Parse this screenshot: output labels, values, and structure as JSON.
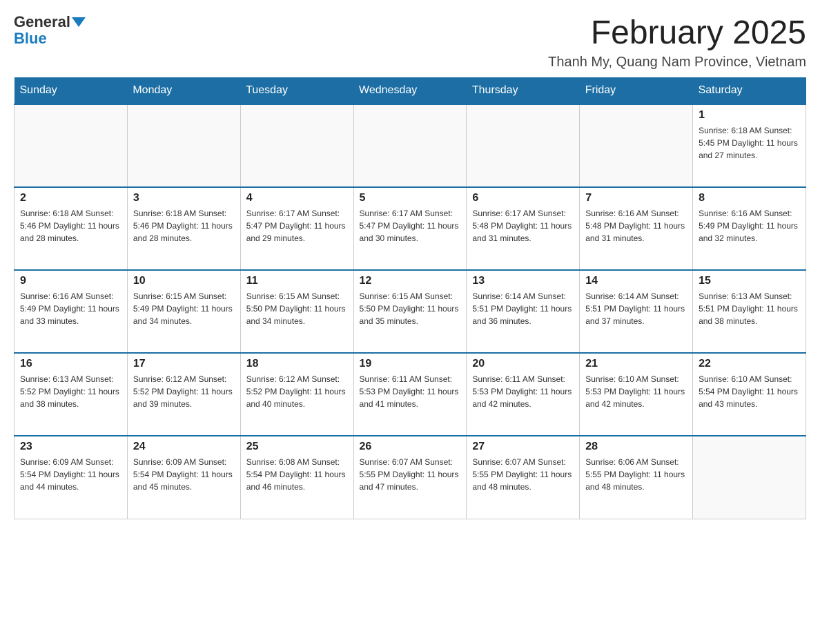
{
  "header": {
    "logo_general": "General",
    "logo_blue": "Blue",
    "title": "February 2025",
    "subtitle": "Thanh My, Quang Nam Province, Vietnam"
  },
  "weekdays": [
    "Sunday",
    "Monday",
    "Tuesday",
    "Wednesday",
    "Thursday",
    "Friday",
    "Saturday"
  ],
  "weeks": [
    [
      {
        "day": "",
        "info": ""
      },
      {
        "day": "",
        "info": ""
      },
      {
        "day": "",
        "info": ""
      },
      {
        "day": "",
        "info": ""
      },
      {
        "day": "",
        "info": ""
      },
      {
        "day": "",
        "info": ""
      },
      {
        "day": "1",
        "info": "Sunrise: 6:18 AM\nSunset: 5:45 PM\nDaylight: 11 hours and 27 minutes."
      }
    ],
    [
      {
        "day": "2",
        "info": "Sunrise: 6:18 AM\nSunset: 5:46 PM\nDaylight: 11 hours and 28 minutes."
      },
      {
        "day": "3",
        "info": "Sunrise: 6:18 AM\nSunset: 5:46 PM\nDaylight: 11 hours and 28 minutes."
      },
      {
        "day": "4",
        "info": "Sunrise: 6:17 AM\nSunset: 5:47 PM\nDaylight: 11 hours and 29 minutes."
      },
      {
        "day": "5",
        "info": "Sunrise: 6:17 AM\nSunset: 5:47 PM\nDaylight: 11 hours and 30 minutes."
      },
      {
        "day": "6",
        "info": "Sunrise: 6:17 AM\nSunset: 5:48 PM\nDaylight: 11 hours and 31 minutes."
      },
      {
        "day": "7",
        "info": "Sunrise: 6:16 AM\nSunset: 5:48 PM\nDaylight: 11 hours and 31 minutes."
      },
      {
        "day": "8",
        "info": "Sunrise: 6:16 AM\nSunset: 5:49 PM\nDaylight: 11 hours and 32 minutes."
      }
    ],
    [
      {
        "day": "9",
        "info": "Sunrise: 6:16 AM\nSunset: 5:49 PM\nDaylight: 11 hours and 33 minutes."
      },
      {
        "day": "10",
        "info": "Sunrise: 6:15 AM\nSunset: 5:49 PM\nDaylight: 11 hours and 34 minutes."
      },
      {
        "day": "11",
        "info": "Sunrise: 6:15 AM\nSunset: 5:50 PM\nDaylight: 11 hours and 34 minutes."
      },
      {
        "day": "12",
        "info": "Sunrise: 6:15 AM\nSunset: 5:50 PM\nDaylight: 11 hours and 35 minutes."
      },
      {
        "day": "13",
        "info": "Sunrise: 6:14 AM\nSunset: 5:51 PM\nDaylight: 11 hours and 36 minutes."
      },
      {
        "day": "14",
        "info": "Sunrise: 6:14 AM\nSunset: 5:51 PM\nDaylight: 11 hours and 37 minutes."
      },
      {
        "day": "15",
        "info": "Sunrise: 6:13 AM\nSunset: 5:51 PM\nDaylight: 11 hours and 38 minutes."
      }
    ],
    [
      {
        "day": "16",
        "info": "Sunrise: 6:13 AM\nSunset: 5:52 PM\nDaylight: 11 hours and 38 minutes."
      },
      {
        "day": "17",
        "info": "Sunrise: 6:12 AM\nSunset: 5:52 PM\nDaylight: 11 hours and 39 minutes."
      },
      {
        "day": "18",
        "info": "Sunrise: 6:12 AM\nSunset: 5:52 PM\nDaylight: 11 hours and 40 minutes."
      },
      {
        "day": "19",
        "info": "Sunrise: 6:11 AM\nSunset: 5:53 PM\nDaylight: 11 hours and 41 minutes."
      },
      {
        "day": "20",
        "info": "Sunrise: 6:11 AM\nSunset: 5:53 PM\nDaylight: 11 hours and 42 minutes."
      },
      {
        "day": "21",
        "info": "Sunrise: 6:10 AM\nSunset: 5:53 PM\nDaylight: 11 hours and 42 minutes."
      },
      {
        "day": "22",
        "info": "Sunrise: 6:10 AM\nSunset: 5:54 PM\nDaylight: 11 hours and 43 minutes."
      }
    ],
    [
      {
        "day": "23",
        "info": "Sunrise: 6:09 AM\nSunset: 5:54 PM\nDaylight: 11 hours and 44 minutes."
      },
      {
        "day": "24",
        "info": "Sunrise: 6:09 AM\nSunset: 5:54 PM\nDaylight: 11 hours and 45 minutes."
      },
      {
        "day": "25",
        "info": "Sunrise: 6:08 AM\nSunset: 5:54 PM\nDaylight: 11 hours and 46 minutes."
      },
      {
        "day": "26",
        "info": "Sunrise: 6:07 AM\nSunset: 5:55 PM\nDaylight: 11 hours and 47 minutes."
      },
      {
        "day": "27",
        "info": "Sunrise: 6:07 AM\nSunset: 5:55 PM\nDaylight: 11 hours and 48 minutes."
      },
      {
        "day": "28",
        "info": "Sunrise: 6:06 AM\nSunset: 5:55 PM\nDaylight: 11 hours and 48 minutes."
      },
      {
        "day": "",
        "info": ""
      }
    ]
  ]
}
